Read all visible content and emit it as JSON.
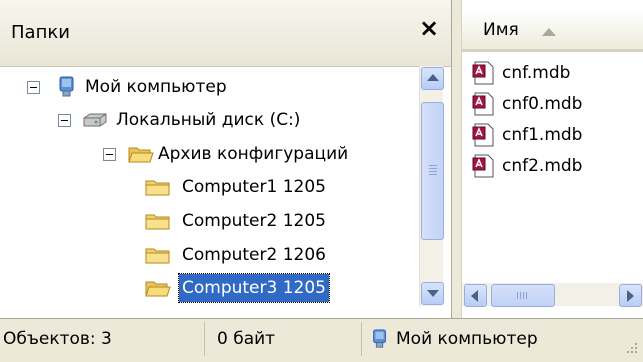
{
  "folders_pane": {
    "title": "Папки",
    "close_glyph": "×",
    "tree": [
      {
        "label": "Мой компьютер",
        "icon": "my-computer-icon",
        "expanded": true
      },
      {
        "label": "Локальный диск (C:)",
        "icon": "hard-disk-icon",
        "expanded": true
      },
      {
        "label": "Архив конфигураций",
        "icon": "folder-open-icon",
        "expanded": true
      },
      {
        "label": "Computer1 1205",
        "icon": "folder-icon"
      },
      {
        "label": "Computer2 1205",
        "icon": "folder-icon"
      },
      {
        "label": "Computer2 1206",
        "icon": "folder-icon"
      },
      {
        "label": "Computer3 1205",
        "icon": "folder-icon",
        "selected": true
      }
    ]
  },
  "files_pane": {
    "column_name": "Имя",
    "sort": "ascending",
    "files": [
      {
        "label": "cnf.mdb",
        "icon": "access-db-icon"
      },
      {
        "label": "cnf0.mdb",
        "icon": "access-db-icon"
      },
      {
        "label": "cnf1.mdb",
        "icon": "access-db-icon"
      },
      {
        "label": "cnf2.mdb",
        "icon": "access-db-icon"
      }
    ]
  },
  "status_bar": {
    "objects": "Объектов: 3",
    "size": "0 байт",
    "location": "Мой компьютер",
    "location_icon": "my-computer-icon"
  },
  "colors": {
    "selection": "#316ac5",
    "toolbar_bg": "#ece9d8",
    "scroll_accent": "#97aedf"
  }
}
